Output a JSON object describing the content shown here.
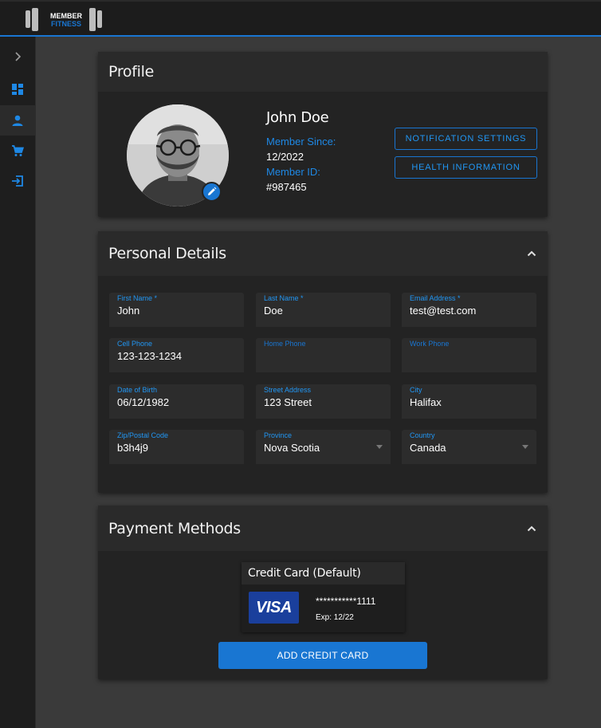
{
  "brand": {
    "line1": "MEMBER",
    "line2": "FITNESS"
  },
  "sidebar": {
    "items": [
      {
        "icon": "chevron-right-icon"
      },
      {
        "icon": "dashboard-icon"
      },
      {
        "icon": "person-icon",
        "active": true
      },
      {
        "icon": "cart-icon"
      },
      {
        "icon": "logout-icon"
      }
    ]
  },
  "profile": {
    "title": "Profile",
    "name": "John Doe",
    "member_since_label": "Member Since:",
    "member_since": "12/2022",
    "member_id_label": "Member ID:",
    "member_id": "#987465",
    "notification_button": "NOTIFICATION SETTINGS",
    "health_button": "HEALTH INFORMATION"
  },
  "personal": {
    "title": "Personal Details",
    "fields": {
      "first_name": {
        "label": "First Name *",
        "value": "John"
      },
      "last_name": {
        "label": "Last Name *",
        "value": "Doe"
      },
      "email": {
        "label": "Email Address *",
        "value": "test@test.com"
      },
      "cell_phone": {
        "label": "Cell Phone",
        "value": "123-123-1234"
      },
      "home_phone": {
        "label": "Home Phone",
        "value": ""
      },
      "work_phone": {
        "label": "Work Phone",
        "value": ""
      },
      "dob": {
        "label": "Date of Birth",
        "value": "06/12/1982"
      },
      "street": {
        "label": "Street Address",
        "value": "123 Street"
      },
      "city": {
        "label": "City",
        "value": "Halifax"
      },
      "postal": {
        "label": "Zip/Postal Code",
        "value": "b3h4j9"
      },
      "province": {
        "label": "Province",
        "value": "Nova Scotia"
      },
      "country": {
        "label": "Country",
        "value": "Canada"
      }
    }
  },
  "payment": {
    "title": "Payment Methods",
    "card_title": "Credit Card (Default)",
    "card_brand": "VISA",
    "card_number": "***********1111",
    "card_exp": "Exp: 12/22",
    "add_button": "ADD CREDIT CARD"
  },
  "colors": {
    "accent": "#1976d2",
    "background": "#3a3a3a",
    "card": "#232323"
  }
}
